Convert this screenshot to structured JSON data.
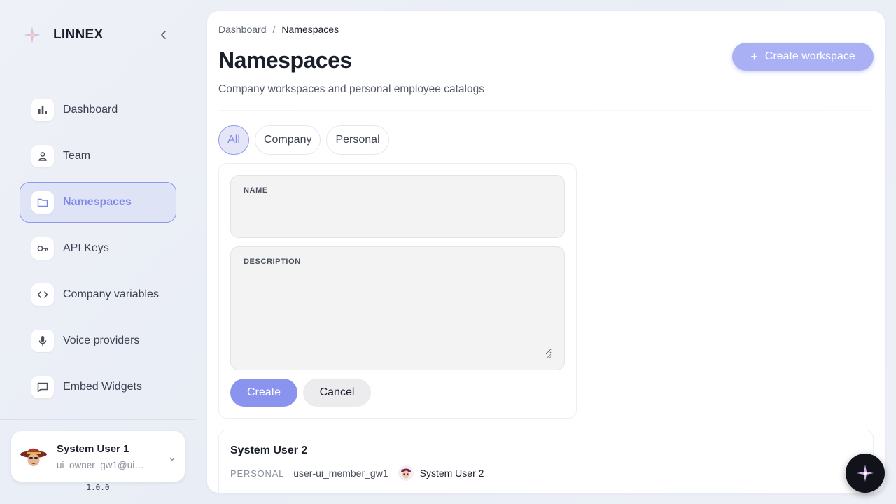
{
  "brand": {
    "name": "LINNEX"
  },
  "nav": [
    {
      "label": "Dashboard",
      "icon": "bar-chart-icon"
    },
    {
      "label": "Team",
      "icon": "user-icon"
    },
    {
      "label": "Namespaces",
      "icon": "folder-icon",
      "active": true
    },
    {
      "label": "API Keys",
      "icon": "key-icon"
    },
    {
      "label": "Company variables",
      "icon": "code-icon"
    },
    {
      "label": "Voice providers",
      "icon": "microphone-icon"
    },
    {
      "label": "Embed Widgets",
      "icon": "chat-bubble-icon"
    }
  ],
  "user": {
    "name": "System User 1",
    "email": "ui_owner_gw1@ui_..."
  },
  "version": "1.0.0",
  "breadcrumb": {
    "root": "Dashboard",
    "separator": "/",
    "current": "Namespaces"
  },
  "page": {
    "title": "Namespaces",
    "subtitle": "Company workspaces and personal employee catalogs",
    "create_workspace_label": "Create workspace"
  },
  "filters": [
    "All",
    "Company",
    "Personal"
  ],
  "form": {
    "name_label": "NAME",
    "name_value": "",
    "description_label": "DESCRIPTION",
    "description_value": "",
    "create_label": "Create",
    "cancel_label": "Cancel"
  },
  "namespaces": [
    {
      "title": "System User 2",
      "type": "PERSONAL",
      "slug": "user-ui_member_gw1",
      "owner": "System User 2"
    }
  ],
  "colors": {
    "accent": "#8a93ee",
    "accent_light": "#a9b0f4",
    "active_bg": "#dfe3f6"
  }
}
